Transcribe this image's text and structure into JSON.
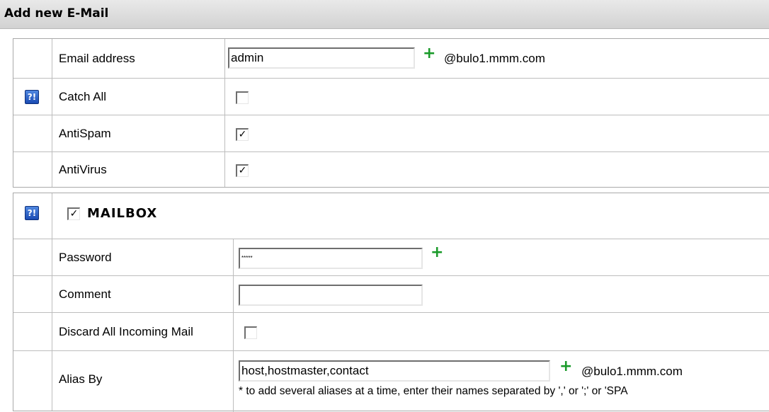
{
  "header": {
    "title": "Add new E-Mail"
  },
  "general": {
    "email_label": "Email address",
    "email_value": "admin",
    "email_domain": "@bulo1.mmm.com",
    "catch_all_label": "Catch All",
    "catch_all_checked": "",
    "antispam_label": "AntiSpam",
    "antispam_checked": "✓",
    "antivirus_label": "AntiVirus",
    "antivirus_checked": "✓"
  },
  "mailbox": {
    "title": "MAILBOX",
    "enabled_checked": "✓",
    "password_label": "Password",
    "password_value": "*****",
    "comment_label": "Comment",
    "comment_value": "",
    "discard_label": "Discard All Incoming Mail",
    "discard_checked": "",
    "alias_label": "Alias By",
    "alias_value": "host,hostmaster,contact",
    "alias_domain": "@bulo1.mmm.com",
    "alias_hint": "* to add several aliases at a time, enter their names separated by ',' or ';' or 'SPA"
  },
  "icons": {
    "help": "help-icon",
    "add": "plus-icon"
  },
  "colors": {
    "plus": "#1a9a2a",
    "help_icon": "#1b4bb3"
  },
  "plus_glyph": "+",
  "help_glyph": "?!"
}
